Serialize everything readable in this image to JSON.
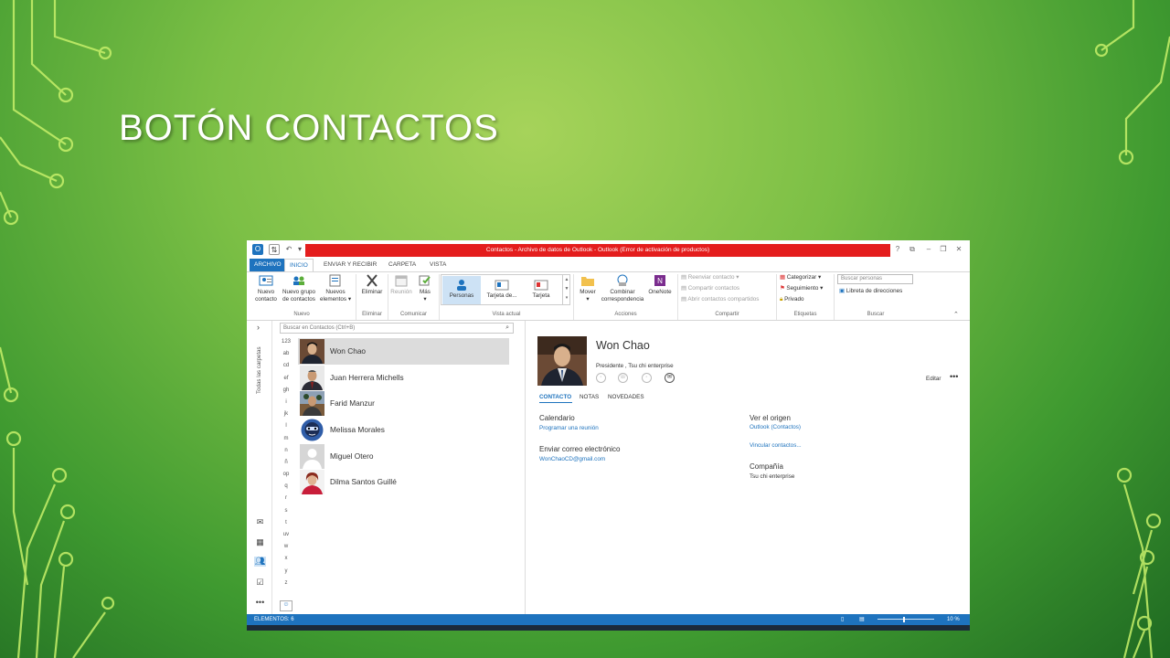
{
  "slide": {
    "title": "BOTÓN CONTACTOS"
  },
  "window": {
    "title": "Contactos - Archivo de datos de Outlook - Outlook (Error de activación de productos)",
    "controls": [
      "?",
      "⧉",
      "–",
      "❐",
      "✕"
    ]
  },
  "ribbon_tabs": [
    "ARCHIVO",
    "INICIO",
    "ENVIAR Y RECIBIR",
    "CARPETA",
    "VISTA"
  ],
  "ribbon": {
    "nuevo_contacto": [
      "Nuevo",
      "contacto"
    ],
    "nuevo_grupo": [
      "Nuevo grupo",
      "de contactos"
    ],
    "nuevos_elementos": [
      "Nuevos",
      "elementos ▾"
    ],
    "eliminar": "Eliminar",
    "reunion": "Reunión",
    "mas": [
      "Más",
      "▾"
    ],
    "gallery": [
      "Personas",
      "Tarjeta de...",
      "Tarjeta"
    ],
    "mover": [
      "Mover",
      "▾"
    ],
    "combinar": [
      "Combinar",
      "correspondencia"
    ],
    "onenote": "OneNote",
    "compartir_items": [
      "Reenviar contacto ▾",
      "Compartir contactos",
      "Abrir contactos compartidos"
    ],
    "etiquetas_items": [
      "Categorizar ▾",
      "Seguimiento ▾",
      "Privado"
    ],
    "buscar_placeholder": "Buscar personas",
    "libreta": "Libreta de direcciones",
    "groups": [
      "Nuevo",
      "Eliminar",
      "Comunicar",
      "Vista actual",
      "Acciones",
      "Compartir",
      "Etiquetas",
      "Buscar"
    ]
  },
  "nav": {
    "all_folders": "Todas las carpetas",
    "collapse": "›"
  },
  "search": {
    "placeholder": "Buscar en Contactos (Ctrl+B)"
  },
  "alpha_index": [
    "123",
    "ab",
    "cd",
    "ef",
    "gh",
    "i",
    "jk",
    "l",
    "m",
    "n",
    "ñ",
    "op",
    "q",
    "r",
    "s",
    "t",
    "uv",
    "w",
    "x",
    "y",
    "z"
  ],
  "contacts": [
    {
      "name": "Won Chao",
      "selected": true
    },
    {
      "name": "Juan Herrera Michells"
    },
    {
      "name": "Farid Manzur"
    },
    {
      "name": "Melissa Morales"
    },
    {
      "name": "Miguel Otero"
    },
    {
      "name": "Dilma Santos Guillé"
    }
  ],
  "detail": {
    "name": "Won Chao",
    "subtitle": "Presidente , Tsu chi enterprise",
    "edit": "Editar",
    "more": "•••",
    "tabs": [
      "CONTACTO",
      "NOTAS",
      "NOVEDADES"
    ],
    "calendario_label": "Calendario",
    "calendario_link": "Programar una reunión",
    "email_label": "Enviar correo electrónico",
    "email_link": "WonChaoCD@gmail.com",
    "origen_label": "Ver el origen",
    "origen_link": "Outlook (Contactos)",
    "vincular_link": "Vincular contactos...",
    "compania_label": "Compañía",
    "compania_value": "Tsu chi enterprise"
  },
  "status": {
    "items": "ELEMENTOS: 6",
    "zoom": "10 %"
  },
  "colors": {
    "accent": "#1e73be",
    "title_error": "#e41d1d",
    "background": "#7bbf45"
  }
}
